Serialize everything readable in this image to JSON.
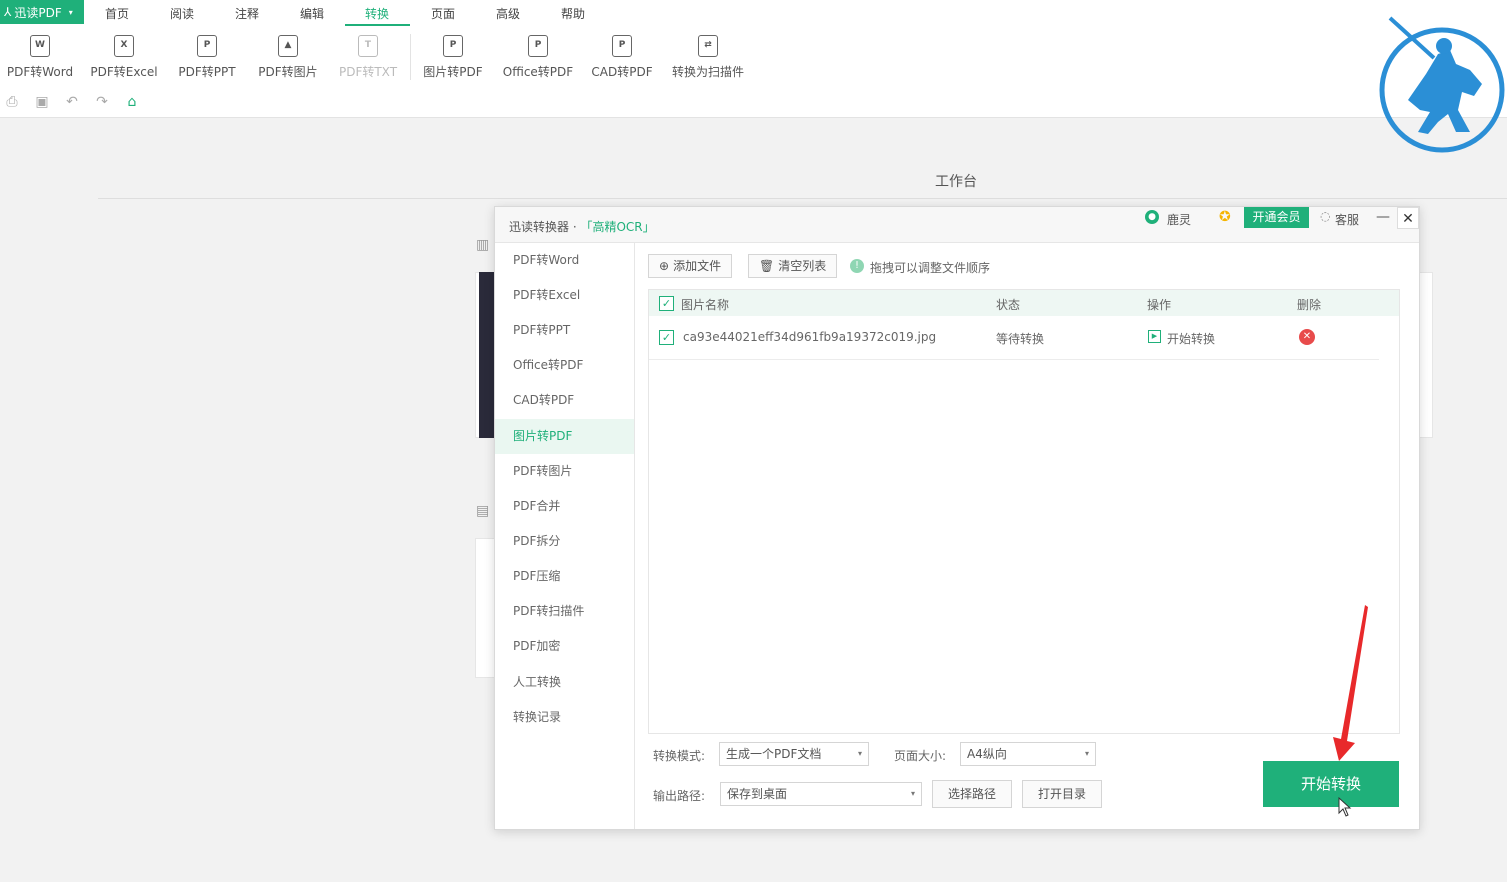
{
  "menubar": {
    "app_label": "迅读PDF",
    "items": [
      "首页",
      "阅读",
      "注释",
      "编辑",
      "转换",
      "页面",
      "高级",
      "帮助"
    ],
    "active": "转换"
  },
  "ribbon": {
    "buttons": [
      {
        "label": "PDF转Word",
        "glyph": "W",
        "icon": "pdf-to-word-icon"
      },
      {
        "label": "PDF转Excel",
        "glyph": "X",
        "icon": "pdf-to-excel-icon"
      },
      {
        "label": "PDF转PPT",
        "glyph": "P",
        "icon": "pdf-to-ppt-icon"
      },
      {
        "label": "PDF转图片",
        "glyph": "▲",
        "icon": "pdf-to-image-icon"
      },
      {
        "label": "PDF转TXT",
        "glyph": "T",
        "icon": "pdf-to-txt-icon",
        "disabled": true
      },
      {
        "label": "图片转PDF",
        "glyph": "P",
        "icon": "image-to-pdf-icon"
      },
      {
        "label": "Office转PDF",
        "glyph": "P",
        "icon": "office-to-pdf-icon"
      },
      {
        "label": "CAD转PDF",
        "glyph": "P",
        "icon": "cad-to-pdf-icon"
      },
      {
        "label": "转换为扫描件",
        "glyph": "⇄",
        "icon": "scan-convert-icon"
      }
    ],
    "quick_access": [
      "print-icon",
      "save-icon",
      "undo-icon",
      "redo-icon",
      "home-icon"
    ]
  },
  "workspace": {
    "title": "工作台"
  },
  "dialog": {
    "title": "迅读转换器 · ",
    "ocr_label": "「高精OCR」",
    "user_name": "鹿灵",
    "vip_button": "开通会员",
    "service_label": "客服",
    "minimize": "—",
    "close": "✕",
    "nav": [
      "PDF转Word",
      "PDF转Excel",
      "PDF转PPT",
      "Office转PDF",
      "CAD转PDF",
      "图片转PDF",
      "PDF转图片",
      "PDF合并",
      "PDF拆分",
      "PDF压缩",
      "PDF转扫描件",
      "PDF加密",
      "人工转换",
      "转换记录"
    ],
    "nav_active": "图片转PDF",
    "toolbar": {
      "add_file": "添加文件",
      "clear_list": "清空列表",
      "hint": "拖拽可以调整文件顺序"
    },
    "table": {
      "headers": {
        "name": "图片名称",
        "status": "状态",
        "action": "操作",
        "delete": "删除"
      },
      "rows": [
        {
          "name": "ca93e44021eff34d961fb9a19372c019.jpg",
          "status": "等待转换",
          "action": "开始转换",
          "checked": true
        }
      ]
    },
    "options": {
      "mode_label": "转换模式:",
      "mode_value": "生成一个PDF文档",
      "page_size_label": "页面大小:",
      "page_size_value": "A4纵向",
      "output_label": "输出路径:",
      "output_value": "保存到桌面",
      "choose_path": "选择路径",
      "open_dir": "打开目录"
    },
    "start_button": "开始转换"
  },
  "colors": {
    "accent": "#1fb07a",
    "delete": "#e84b4b",
    "logo": "#2b8fd6",
    "annotation_arrow": "#e8292b"
  }
}
